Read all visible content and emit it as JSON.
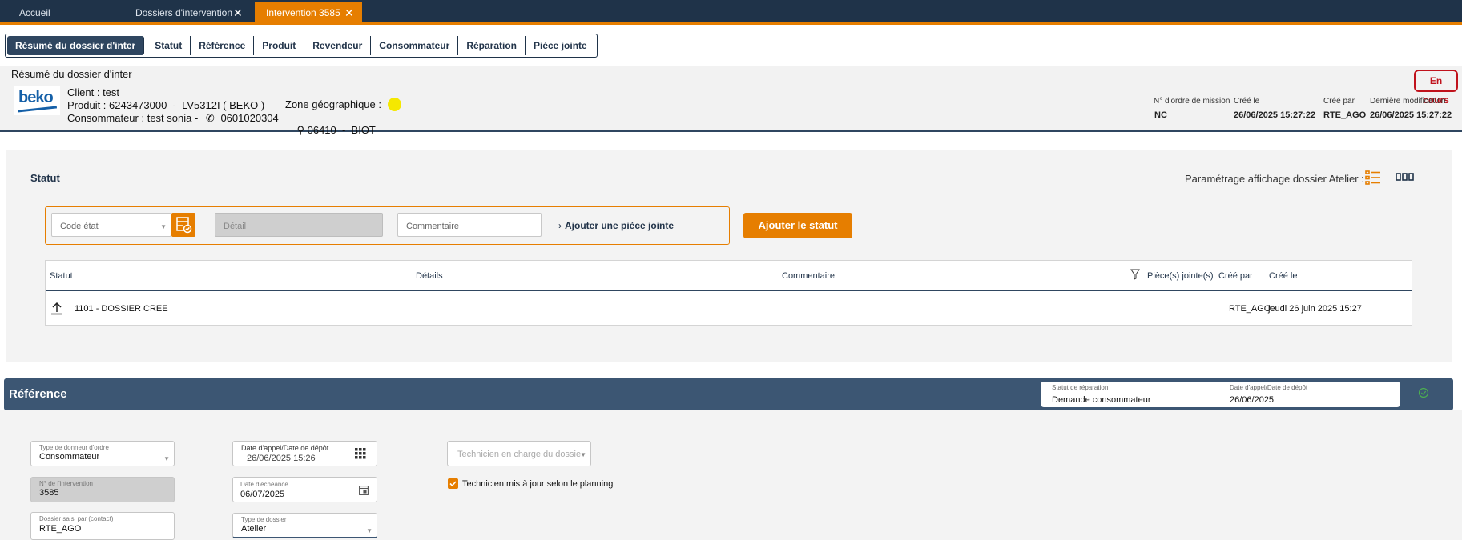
{
  "tabs": [
    {
      "label": "Accueil",
      "closable": false
    },
    {
      "label": "Dossiers d'intervention",
      "closable": true
    },
    {
      "label": "Intervention 3585",
      "closable": true,
      "active": true
    }
  ],
  "subnav": [
    "Résumé du dossier d'inter",
    "Statut",
    "Référence",
    "Produit",
    "Revendeur",
    "Consommateur",
    "Réparation",
    "Pièce jointe"
  ],
  "summary": {
    "title": "Résumé du dossier d'inter",
    "logo_text": "beko",
    "client": "Client : test",
    "produit_label": "Produit : ",
    "produit_value": "6243473000  -  LV5312I ( BEKO )",
    "consommateur_label": "Consommateur : ",
    "consommateur_value": "test sonia -",
    "phone": "0601020304",
    "zone_label": "Zone géographique :",
    "location": "06410  -  BIOT",
    "status_badge": "En cours",
    "meta_labels": [
      "N° d'ordre de mission",
      "Créé le",
      "Créé par",
      "Dernière modification"
    ],
    "meta_values": [
      "NC",
      "26/06/2025 15:27:22",
      "RTE_AGO",
      "26/06/2025 15:27:22"
    ],
    "zone_color": "#f5e800"
  },
  "statut": {
    "title": "Statut",
    "settings_label": "Paramétrage affichage dossier Atelier :",
    "code_etat_placeholder": "Code état",
    "detail_placeholder": "Détail",
    "commentaire_placeholder": "Commentaire",
    "add_attachment": "Ajouter une pièce jointe",
    "add_status_button": "Ajouter le statut",
    "table_headers": [
      "Statut",
      "Détails",
      "Commentaire",
      "Pièce(s) jointe(s)",
      "Créé par",
      "Créé le"
    ],
    "rows": [
      {
        "statut": "1101 - DOSSIER CREE",
        "details": "",
        "commentaire": "",
        "pj": "",
        "cree_par": "RTE_AGO",
        "cree_le": "jeudi 26 juin 2025 15:27"
      }
    ]
  },
  "reference": {
    "title": "Référence",
    "header_fields": [
      {
        "label": "Statut de réparation",
        "value": "Demande consommateur"
      },
      {
        "label": "Date d'appel/Date de dépôt",
        "value": "26/06/2025"
      }
    ],
    "type_donneur": {
      "label": "Type de donneur d'ordre",
      "value": "Consommateur"
    },
    "num_intervention": {
      "label": "N° de l'intervention",
      "value": "3585"
    },
    "dossier_saisi": {
      "label": "Dossier saisi par (contact)",
      "value": "RTE_AGO"
    },
    "date_appel": {
      "label": "Date d'appel/Date de dépôt",
      "value": "26/06/2025 15:26"
    },
    "date_echeance": {
      "label": "Date d'échéance",
      "value": "06/07/2025"
    },
    "type_dossier": {
      "label": "Type de dossier",
      "value": "Atelier"
    },
    "technicien_placeholder": "Technicien en charge du dossie",
    "technicien_checkbox": "Technicien mis à jour selon le planning"
  },
  "colors": {
    "navy": "#1f3349",
    "orange": "#e67e00",
    "panel": "#3c5673",
    "badge_red": "#c0121c"
  }
}
